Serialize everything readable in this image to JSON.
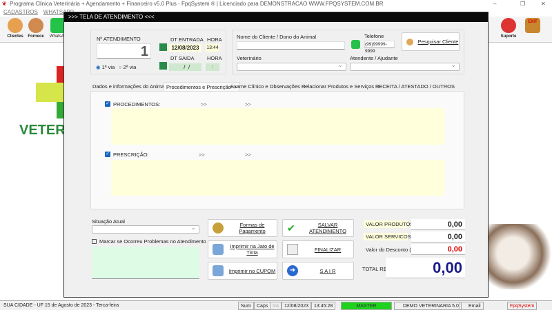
{
  "app_title": "Programa Clinica Veterinária + Agendamento + Financeiro v5.0 Plus - FpqSystem ® | Licenciado para  DEMONSTRACAO WWW.FPQSYSTEM.COM.BR",
  "menu": [
    "CADASTROS",
    "WHATSAPP"
  ],
  "toolbar": {
    "clientes": "Clientes",
    "fornece": "Fornece",
    "whatsapp": "WhatsAp",
    "suporte": "Suporte",
    "exit": "EXIT"
  },
  "background_logo": "VETER",
  "dialog": {
    "title": ">>>    TELA DE ATENDIMENTO    <<<",
    "n_atendimento_label": "Nº ATENDIMENTO",
    "n_atendimento": "1",
    "via1": "1ª via",
    "via2": "2ª via",
    "dt_entrada_label": "DT ENTRADA",
    "dt_entrada": "12/08/2023",
    "hora_label": "HORA",
    "hora_entrada": "13:44",
    "dt_saida_label": "DT SAIDA",
    "dt_saida": "  /  /",
    "hora_saida": ":",
    "cliente_label": "Nome do Cliente / Dono do Animal",
    "cliente": "",
    "telefone_label": "Telefone",
    "telefone": "(99)99999-9999",
    "pesquisar": "Pesquisar Cliente",
    "veterinario_label": "Veterinário",
    "atendente_label": "Atendente / Ajudante",
    "tabs": [
      {
        "label": "Dados e informações do Animal ->"
      },
      {
        "label": "Procedimentos e Prescrição ->"
      },
      {
        "label": "Exame Clínico e Observações ->"
      },
      {
        "label": "Relacionar Produtos e Serviços ->"
      },
      {
        "label": "RECEITA / ATESTADO / OUTROS"
      }
    ],
    "procedimentos_label": "PROCEDIMENTOS:",
    "prescricao_label": "PRESCRIÇÃO:",
    "arrows": ">>",
    "situacao_label": "Situação Atual",
    "problemas_label": "Marcar se Ocorreu Problemas no Atendimento",
    "buttons": {
      "pagamento": "Formas de Pagamento",
      "salvar": "SALVAR  ATENDIMENTO",
      "jato": "Imprimir na Jato de Tinta",
      "finalizar": "FINALIZAR",
      "cupom": "Imprimir no CUPOM",
      "sair": "S A I R"
    },
    "totals": {
      "produtos_label": "VALOR PRODUTOS",
      "produtos": "0,00",
      "servicos_label": "VALOR SERVICOS",
      "servicos": "0,00",
      "desconto_label": "Valor do Desconto ( - )",
      "desconto": "0,00",
      "total_label": "TOTAL R$",
      "total": "0,00"
    }
  },
  "status": {
    "city": "SUA CIDADE - UF 15 de Agosto de 2023 - Terca-feira",
    "num": "Num",
    "caps": "Caps",
    "ins": "Ins",
    "date": "12/08/2023",
    "time": "13:45:28",
    "user": "MASTER",
    "company": "DEMO VETERINARIA 5.0",
    "email": "Email",
    "brand": "FpqSystem"
  }
}
